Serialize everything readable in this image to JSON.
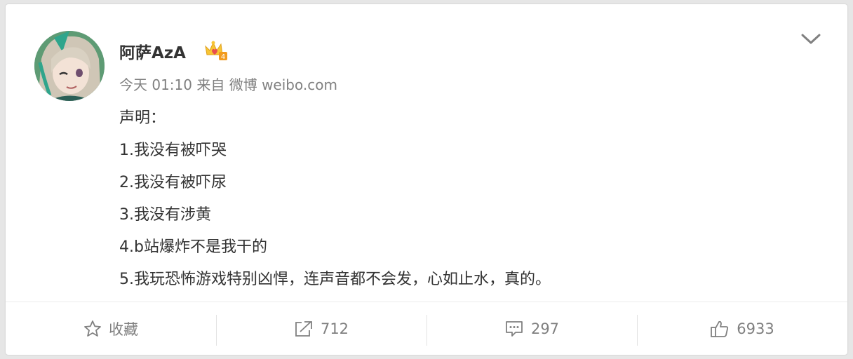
{
  "post": {
    "author": "阿萨AzA",
    "badge_icon": "crown-heart-badge-icon",
    "time": "今天 01:10",
    "source": "来自 微博 weibo.com",
    "lines": [
      "声明：",
      "1.我没有被吓哭",
      "2.我没有被吓尿",
      "3.我没有涉黄",
      "4.b站爆炸不是我干的",
      "5.我玩恐怖游戏特别凶悍，连声音都不会发，心如止水，真的。"
    ]
  },
  "actions": {
    "favorite": {
      "label": "收藏",
      "icon": "star-icon"
    },
    "repost": {
      "count": "712",
      "icon": "share-arrow-icon"
    },
    "comment": {
      "count": "297",
      "icon": "comment-icon"
    },
    "like": {
      "count": "6933",
      "icon": "thumbs-up-icon"
    }
  },
  "colors": {
    "text_primary": "#333333",
    "text_muted": "#808080",
    "background": "#e6e6e6",
    "card": "#ffffff"
  }
}
